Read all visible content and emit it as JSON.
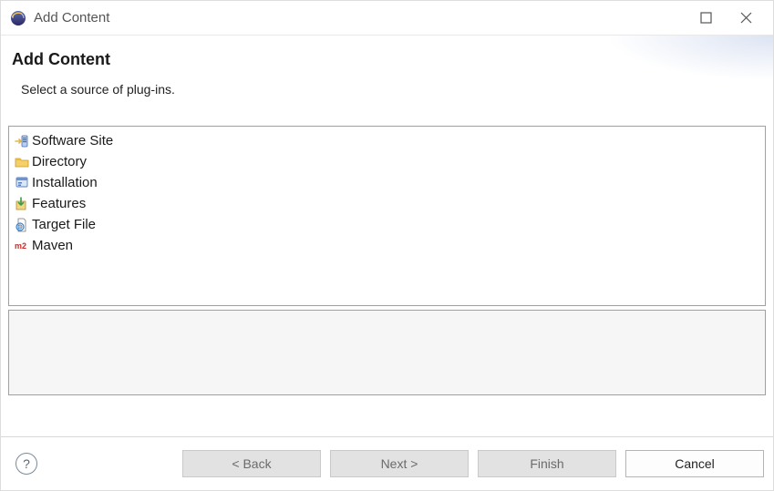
{
  "titlebar": {
    "title": "Add Content"
  },
  "header": {
    "heading": "Add Content",
    "subtitle": "Select a source of plug-ins."
  },
  "sources": [
    {
      "id": "software-site",
      "label": "Software Site",
      "icon": "software-site-icon"
    },
    {
      "id": "directory",
      "label": "Directory",
      "icon": "folder-icon"
    },
    {
      "id": "installation",
      "label": "Installation",
      "icon": "installation-icon"
    },
    {
      "id": "features",
      "label": "Features",
      "icon": "features-icon"
    },
    {
      "id": "target-file",
      "label": "Target File",
      "icon": "target-file-icon"
    },
    {
      "id": "maven",
      "label": "Maven",
      "icon": "maven-icon"
    }
  ],
  "buttons": {
    "back": "< Back",
    "next": "Next >",
    "finish": "Finish",
    "cancel": "Cancel",
    "help": "?"
  }
}
